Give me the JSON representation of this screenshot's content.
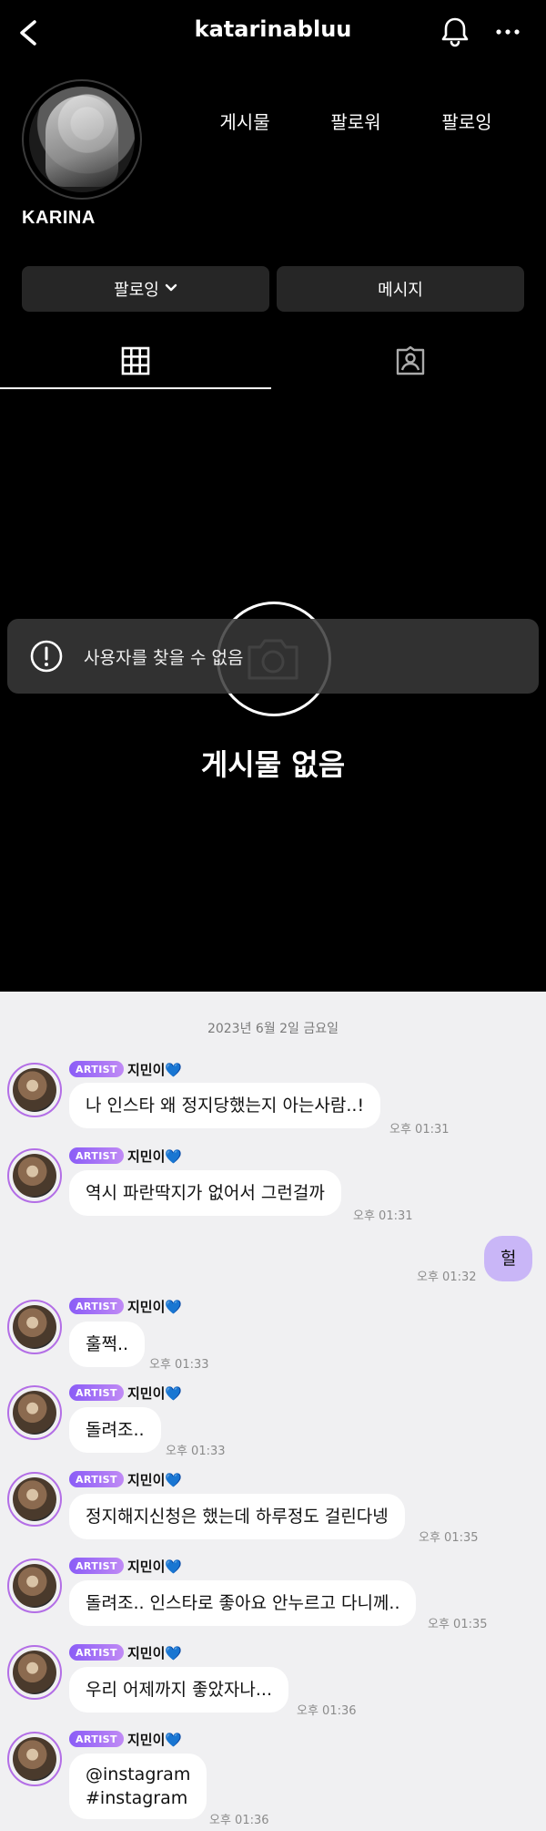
{
  "profile": {
    "username": "katarinabluu",
    "display_name": "KARINA",
    "stats": {
      "posts_label": "게시물",
      "followers_label": "팔로워",
      "following_label": "팔로잉"
    },
    "buttons": {
      "following": "팔로잉",
      "message": "메시지"
    },
    "empty_state": "게시물 없음",
    "toast": "사용자를 찾을 수 없음"
  },
  "chat": {
    "date": "2023년 6월 2일 금요일",
    "badge": "ARTIST",
    "sender": "지민이",
    "sender_emoji": "💙",
    "messages": [
      {
        "text": "나 인스타 왜 정지당했는지 아는사람..!",
        "time": "오후 01:31"
      },
      {
        "text": "역시 파란딱지가 없어서 그런걸까",
        "time": "오후 01:31"
      },
      {
        "text": "훌쩍..",
        "time": "오후 01:33"
      },
      {
        "text": "돌려조..",
        "time": "오후 01:33"
      },
      {
        "text": "정지해지신청은 했는데 하루정도 걸린다넹",
        "time": "오후 01:35"
      },
      {
        "text": "돌려조.. 인스타로 좋아요 안누르고 다니께..",
        "time": "오후 01:35"
      },
      {
        "text": "우리 어제까지 좋았자나...",
        "time": "오후 01:36"
      },
      {
        "text_line1": "@instagram",
        "text_line2": "#instagram",
        "time": "오후 01:36"
      }
    ],
    "my_message": {
      "text": "헐",
      "time": "오후 01:32"
    }
  },
  "colors": {
    "accent_purple": "#8a5cf6",
    "my_bubble": "#c9b6f7",
    "chat_bg": "#f0f0f2"
  }
}
